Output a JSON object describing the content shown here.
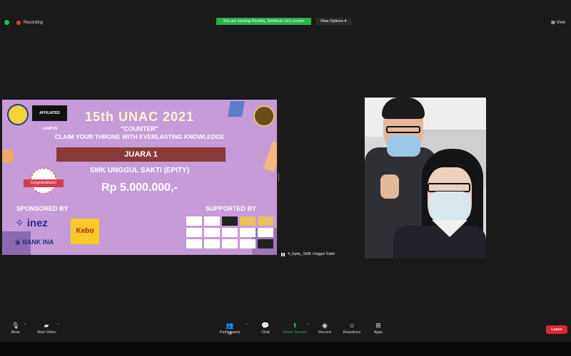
{
  "top": {
    "recording_label": "Recording",
    "share_banner": "You are viewing Pendita_Steffanie Lin's screen",
    "view_options": "View Options ▾",
    "view_button": "View"
  },
  "slide": {
    "campus_logo_text": "AFFILIATED CAMPUS",
    "title": "15th UNAC 2021",
    "subtitle": "\"COUNTER\"",
    "claim": "CLAIM YOUR THRONE WITH EVERLASTING KNOWLEDGE",
    "rank": "JUARA 1",
    "school": "SMK UNGGUL SAKTI (EPITY)",
    "prize": "Rp 5.000.000,-",
    "congrats": "Congratulations!",
    "sponsored_by": "SPONSORED BY",
    "supported_by": "SUPPORTED BY",
    "sponsor1": "inez",
    "sponsor2": "BANK INA",
    "sponsor3": "Kebo"
  },
  "video": {
    "participant_name": "4_Epity_SMK Unggul Sakti"
  },
  "toolbar": {
    "mute": "Mute",
    "start_video": "Start Video",
    "participants": "Participants",
    "participants_count": "38",
    "chat": "Chat",
    "share_screen": "Share Screen",
    "record": "Record",
    "reactions": "Reactions",
    "apps": "Apps",
    "leave": "Leave"
  },
  "colors": {
    "slide_bg": "#c79ad8",
    "banner_green": "#2bb24c",
    "leave_red": "#e0272f",
    "rank_bar": "#8b3a3a"
  }
}
